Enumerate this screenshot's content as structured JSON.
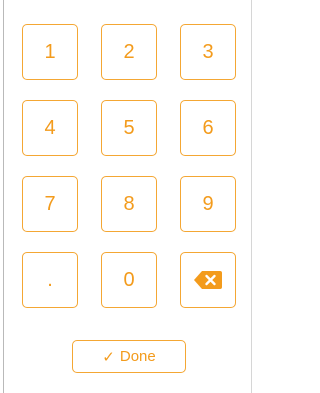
{
  "theme": {
    "accent": "#f39b1c",
    "border": "#f4a734",
    "background": "#ffffff"
  },
  "keypad": {
    "keys": [
      {
        "label": "1"
      },
      {
        "label": "2"
      },
      {
        "label": "3"
      },
      {
        "label": "4"
      },
      {
        "label": "5"
      },
      {
        "label": "6"
      },
      {
        "label": "7"
      },
      {
        "label": "8"
      },
      {
        "label": "9"
      },
      {
        "label": "."
      },
      {
        "label": "0"
      },
      {
        "icon": "backspace-icon"
      }
    ]
  },
  "done": {
    "icon": "check-icon",
    "check_glyph": "✓",
    "label": "Done"
  }
}
